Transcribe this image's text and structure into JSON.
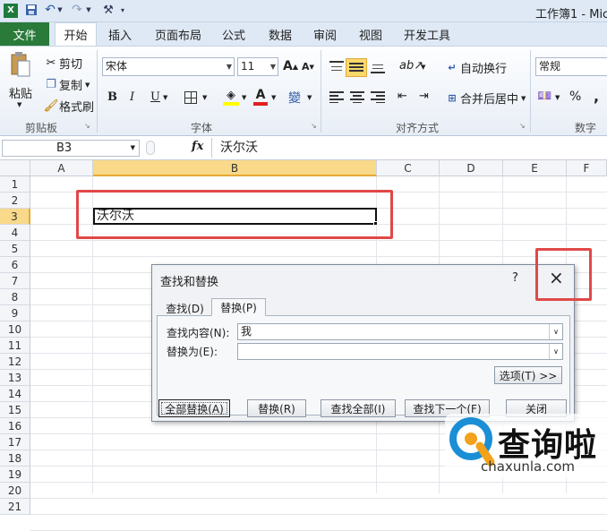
{
  "window": {
    "title": "工作簿1 - Mic"
  },
  "qat": {
    "save_icon": "save-icon",
    "undo_icon": "undo-icon",
    "redo_icon": "redo-icon",
    "tool_icon": "tool-icon"
  },
  "tabs": {
    "file": "文件",
    "home": "开始",
    "insert": "插入",
    "page_layout": "页面布局",
    "formulas": "公式",
    "data": "数据",
    "review": "审阅",
    "view": "视图",
    "developer": "开发工具"
  },
  "ribbon": {
    "clipboard": {
      "paste": "粘贴",
      "cut": "剪切",
      "copy": "复制",
      "format_painter": "格式刷",
      "label": "剪贴板"
    },
    "font": {
      "name": "宋体",
      "size": "11",
      "bold": "B",
      "italic": "I",
      "underline": "U",
      "label": "字体"
    },
    "alignment": {
      "wrap_text": "自动换行",
      "merge_center": "合并后居中",
      "label": "对齐方式"
    },
    "number": {
      "format": "常规",
      "percent": "%",
      "comma": ",",
      "label": "数字"
    }
  },
  "formula_bar": {
    "name_box": "B3",
    "fx": "fx",
    "value": "沃尔沃"
  },
  "grid": {
    "columns": [
      "A",
      "B",
      "C",
      "D",
      "E",
      "F"
    ],
    "rows": [
      "1",
      "2",
      "3",
      "4",
      "5",
      "6",
      "7",
      "8",
      "9",
      "10",
      "11",
      "12",
      "13",
      "14",
      "15",
      "16",
      "17",
      "18",
      "19",
      "20",
      "21"
    ],
    "b3_value": "沃尔沃"
  },
  "dialog": {
    "title": "查找和替换",
    "help": "?",
    "close": "×",
    "tab_find": "查找(D)",
    "tab_replace": "替换(P)",
    "find_label": "查找内容(N):",
    "find_value": "我",
    "replace_label": "替换为(E):",
    "replace_value": "",
    "options": "选项(T) >>",
    "replace_all": "全部替换(A)",
    "replace": "替换(R)",
    "find_all": "查找全部(I)",
    "find_next": "查找下一个(F)",
    "close_button": "关闭"
  },
  "watermark": {
    "logo_text": "查询啦",
    "url": "chaxunla.com"
  }
}
